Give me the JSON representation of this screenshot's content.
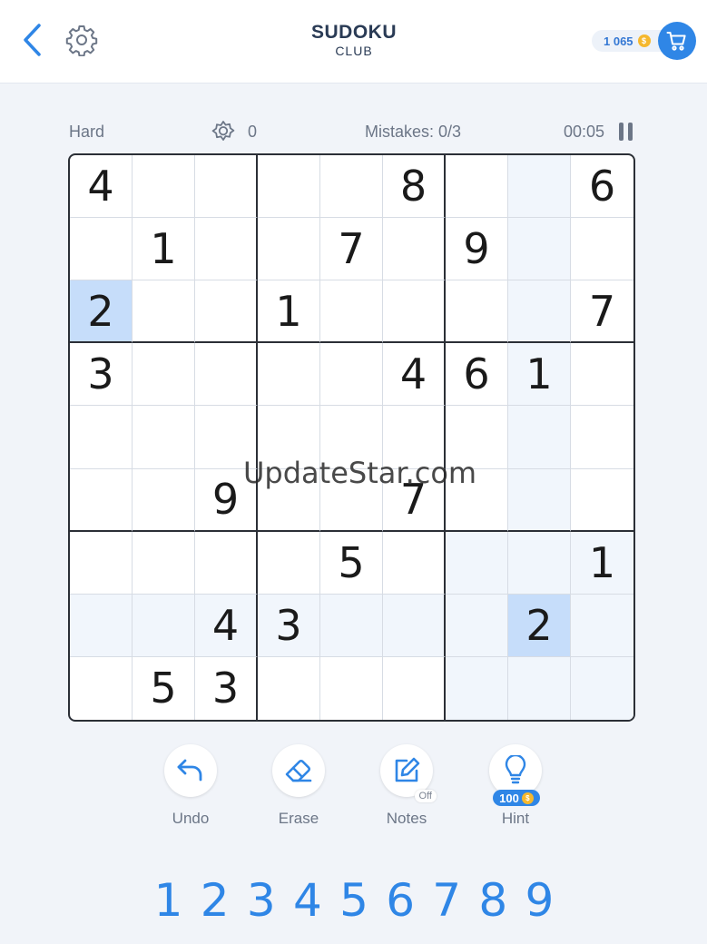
{
  "header": {
    "title": "SUDOKU",
    "subtitle": "CLUB",
    "coins": "1 065",
    "coin_symbol": "$"
  },
  "status": {
    "difficulty": "Hard",
    "score": "0",
    "mistakes": "Mistakes: 0/3",
    "time": "00:05"
  },
  "board": {
    "rows": [
      [
        "4",
        "",
        "",
        "",
        "",
        "8",
        "",
        "",
        "6"
      ],
      [
        "",
        "1",
        "",
        "",
        "7",
        "",
        "9",
        "",
        ""
      ],
      [
        "2",
        "",
        "",
        "1",
        "",
        "",
        "",
        "",
        "7"
      ],
      [
        "3",
        "",
        "",
        "",
        "",
        "4",
        "6",
        "1",
        ""
      ],
      [
        "",
        "",
        "",
        "",
        "",
        "",
        "",
        "",
        ""
      ],
      [
        "",
        "",
        "9",
        "",
        "",
        "7",
        "",
        "",
        ""
      ],
      [
        "",
        "",
        "",
        "",
        "5",
        "",
        "",
        "",
        "1"
      ],
      [
        "",
        "",
        "4",
        "3",
        "",
        "",
        "",
        "2",
        ""
      ],
      [
        "",
        "5",
        "3",
        "",
        "",
        "",
        "",
        "",
        ""
      ]
    ],
    "selected": [
      7,
      7
    ],
    "same_value_highlight": [
      [
        2,
        0
      ]
    ]
  },
  "watermark": "UpdateStar.com",
  "tools": {
    "undo": "Undo",
    "erase": "Erase",
    "notes": "Notes",
    "notes_state": "Off",
    "hint": "Hint",
    "hint_cost": "100"
  },
  "numpad": [
    "1",
    "2",
    "3",
    "4",
    "5",
    "6",
    "7",
    "8",
    "9"
  ],
  "colors": {
    "accent": "#2f86e6",
    "selected_cell": "#c6ddfa",
    "highlight_cell": "#f1f6fc",
    "coin": "#f5b82e"
  }
}
